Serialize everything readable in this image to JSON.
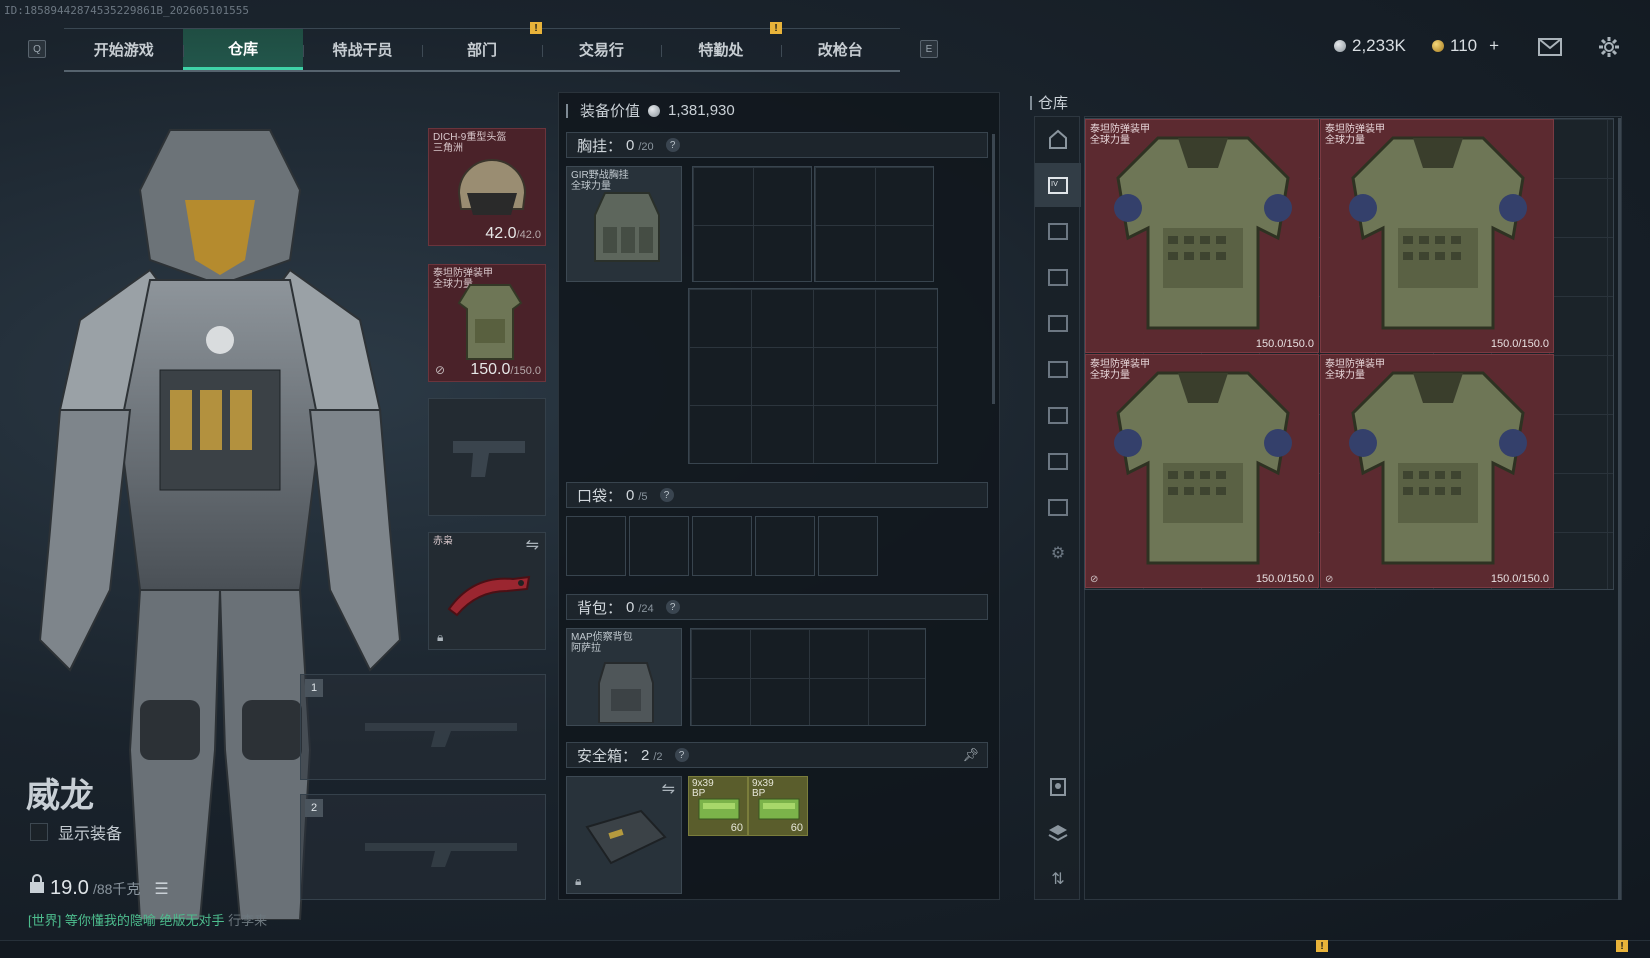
{
  "session_id": "ID:18589442874535229861B_202605101555",
  "nav": {
    "left_key": "Q",
    "right_key": "E",
    "tabs": [
      "开始游戏",
      "仓库",
      "特战干员",
      "部门",
      "交易行",
      "特勤处",
      "改枪台"
    ],
    "active_index": 1
  },
  "currency": {
    "silver": "2,233K",
    "gold": "110",
    "gold_plus": "+"
  },
  "character": {
    "name": "威龙",
    "show_equipment_label": "显示装备",
    "weight_value": "19.0",
    "weight_max": "/88千克"
  },
  "chat": {
    "channel": "[世界]",
    "message": "等你懂我的隐喻 绝版无对手",
    "tail": "行李来"
  },
  "gear": {
    "helmet": {
      "name_line1": "DICH-9重型头盔",
      "name_line2": "三角洲",
      "durability": "42.0",
      "durability_max": "/42.0"
    },
    "armor": {
      "name_line1": "泰坦防弹装甲",
      "name_line2": "全球力量",
      "durability": "150.0",
      "durability_max": "/150.0"
    },
    "melee": {
      "name": "赤枭"
    },
    "weapon_slots": [
      "1",
      "2"
    ]
  },
  "middle": {
    "equipment_value_label": "装备价值",
    "equipment_value": "1,381,930",
    "chest_rig": {
      "label": "胸挂：",
      "count": "0",
      "cap": "/20",
      "item_line1": "GIR野战胸挂",
      "item_line2": "全球力量"
    },
    "pockets": {
      "label": "口袋：",
      "count": "0",
      "cap": "/5"
    },
    "backpack": {
      "label": "背包：",
      "count": "0",
      "cap": "/24",
      "item_line1": "MAP侦察背包",
      "item_line2": "阿萨拉"
    },
    "safe_box": {
      "label": "安全箱：",
      "count": "2",
      "cap": "/2",
      "ammo": [
        {
          "name_line1": "9x39",
          "name_line2": "BP",
          "count": "60"
        },
        {
          "name_line1": "9x39",
          "name_line2": "BP",
          "count": "60"
        }
      ]
    }
  },
  "stash": {
    "title": "仓库",
    "items": [
      {
        "name_line1": "泰坦防弹装甲",
        "name_line2": "全球力量",
        "durability": "150.0/150.0"
      },
      {
        "name_line1": "泰坦防弹装甲",
        "name_line2": "全球力量",
        "durability": "150.0/150.0"
      },
      {
        "name_line1": "泰坦防弹装甲",
        "name_line2": "全球力量",
        "durability": "150.0/150.0"
      },
      {
        "name_line1": "泰坦防弹装甲",
        "name_line2": "全球力量",
        "durability": "150.0/150.0"
      }
    ]
  },
  "colors": {
    "accent_green": "#3fd3a8",
    "item_red": "#5c2a30",
    "notification_yellow": "#e8b33a"
  }
}
